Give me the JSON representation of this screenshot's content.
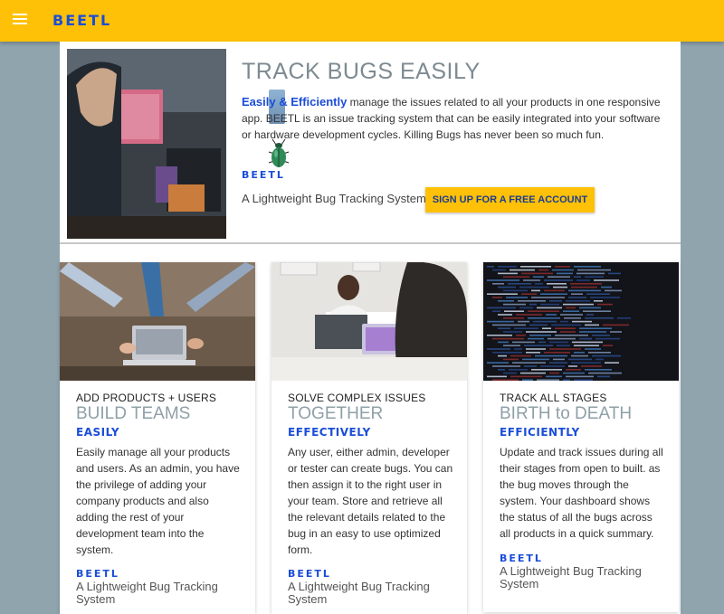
{
  "topbar": {
    "brand": "BEETL",
    "menu_icon": "hamburger-menu-icon"
  },
  "hero": {
    "title": "TRACK BUGS EASILY",
    "lead_bold": "Easily & Efficiently",
    "lead_text": " manage the issues related to all your products in one responsive app. BEETL is an issue tracking system that can be easily integrated into your software or hardware development cycles. Killing Bugs has never been so much fun.",
    "brand": "BEETL",
    "tagline": "A Lightweight Bug Tracking System",
    "cta_label": "SIGN UP FOR A FREE ACCOUNT"
  },
  "cards": [
    {
      "kicker": "ADD PRODUCTS + USERS",
      "title": "BUILD TEAMS",
      "subtitle": "EASILY",
      "body": "Easily manage all your products and users. As an admin, you have the privilege of adding your company products and also adding the rest of your development team into the system.",
      "brand": "BEETL",
      "tagline": "A Lightweight Bug Tracking System"
    },
    {
      "kicker": "SOLVE COMPLEX ISSUES",
      "title": "TOGETHER",
      "subtitle": "EFFECTIVELY",
      "body": "Any user, either admin, developer or tester can create bugs. You can then assign it to the right user in your team. Store and retrieve all the relevant details related to the bug in an easy to use optimized form.",
      "brand": "BEETL",
      "tagline": "A Lightweight Bug Tracking System"
    },
    {
      "kicker": "TRACK ALL STAGES",
      "title": "BIRTH to DEATH",
      "subtitle": "EFFICIENTLY",
      "body": "Update and track issues during all their stages from open to built. as the bug moves through the system. Your dashboard shows the status of all the bugs across all products in a quick summary.",
      "brand": "BEETL",
      "tagline": "A Lightweight Bug Tracking System"
    }
  ],
  "colors": {
    "accent": "#ffc107",
    "brand_blue": "#1a4dd8",
    "background": "#90a4ae"
  }
}
